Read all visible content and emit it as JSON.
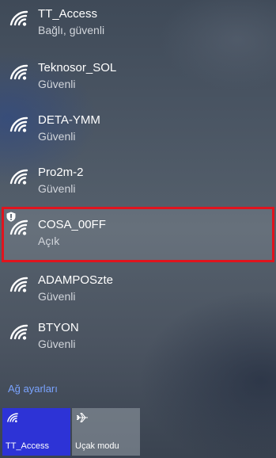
{
  "networks": [
    {
      "ssid": "TT_Access",
      "status": "Bağlı, güvenli",
      "icon": "wifi-icon"
    },
    {
      "ssid": "Teknosor_SOL",
      "status": "Güvenli",
      "icon": "wifi-icon"
    },
    {
      "ssid": "DETA-YMM",
      "status": "Güvenli",
      "icon": "wifi-icon"
    },
    {
      "ssid": "Pro2m-2",
      "status": "Güvenli",
      "icon": "wifi-icon"
    },
    {
      "ssid": "COSA_00FF",
      "status": "Açık",
      "icon": "wifi-open-shield-icon"
    },
    {
      "ssid": "ADAMPOSzte",
      "status": "Güvenli",
      "icon": "wifi-icon"
    },
    {
      "ssid": "BTYON",
      "status": "Güvenli",
      "icon": "wifi-icon"
    }
  ],
  "settings_link": "Ağ ayarları",
  "quick_actions": [
    {
      "label": "TT_Access",
      "icon": "wifi-icon",
      "active": true
    },
    {
      "label": "Uçak modu",
      "icon": "airplane-icon",
      "active": false
    }
  ],
  "colors": {
    "highlight_border": "#e0141e",
    "link": "#7aa3ff",
    "active_tile": "#2d33d6"
  }
}
